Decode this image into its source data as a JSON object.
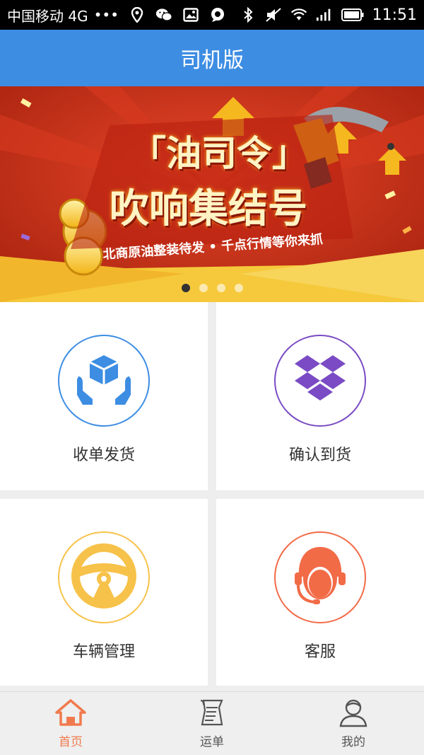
{
  "status_bar": {
    "carrier": "中国移动 4G",
    "dots": "•••",
    "time": "11:51"
  },
  "header": {
    "title": "司机版"
  },
  "banner": {
    "title_line1": "「油司令」",
    "title_line2": "吹响集结号",
    "subtitle": "北商原油整装待发 • 千点行情等你来抓",
    "slide_count": 4,
    "active_slide": 0
  },
  "tiles": [
    {
      "label": "收单发货",
      "icon": "hands-box-icon",
      "color": "#3d8de3"
    },
    {
      "label": "确认到货",
      "icon": "dropbox-icon",
      "color": "#7a4bc4"
    },
    {
      "label": "车辆管理",
      "icon": "steering-wheel-icon",
      "color": "#f7c24a"
    },
    {
      "label": "客服",
      "icon": "customer-service-icon",
      "color": "#f26b47"
    }
  ],
  "tabbar": {
    "items": [
      {
        "label": "首页",
        "icon": "home-icon",
        "active": true
      },
      {
        "label": "运单",
        "icon": "document-icon",
        "active": false
      },
      {
        "label": "我的",
        "icon": "user-icon",
        "active": false
      }
    ],
    "active_color": "#f07a4d"
  }
}
